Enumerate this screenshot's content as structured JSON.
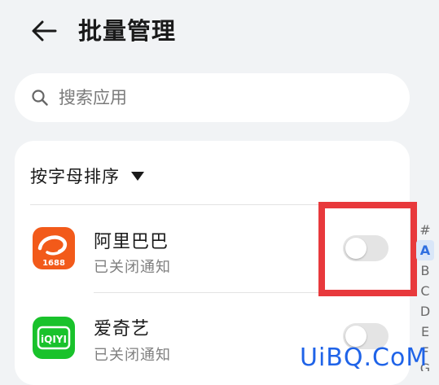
{
  "header": {
    "title": "批量管理",
    "back_icon": "arrow-left-icon"
  },
  "search": {
    "placeholder": "搜索应用",
    "value": "",
    "icon": "search-icon"
  },
  "sort": {
    "label": "按字母排序",
    "icon": "caret-down-icon"
  },
  "apps": [
    {
      "name": "阿里巴巴",
      "status": "已关闭通知",
      "icon_label": "1688",
      "notifications_enabled": false,
      "brand_color": "#f25a1a"
    },
    {
      "name": "爱奇艺",
      "status": "已关闭通知",
      "icon_label": "iQIYI",
      "notifications_enabled": false,
      "brand_color": "#19c22b"
    }
  ],
  "index_bar": {
    "letters": [
      "#",
      "A",
      "B",
      "C",
      "D",
      "E",
      "F",
      "G"
    ],
    "active": "A"
  },
  "watermark": {
    "text": "UiBQ.CoM"
  },
  "colors": {
    "background": "#f1f3f5",
    "card": "#ffffff",
    "highlight_border": "#e8393c",
    "toggle_off": "#e4e4e4",
    "accent": "#2f6fe0"
  }
}
